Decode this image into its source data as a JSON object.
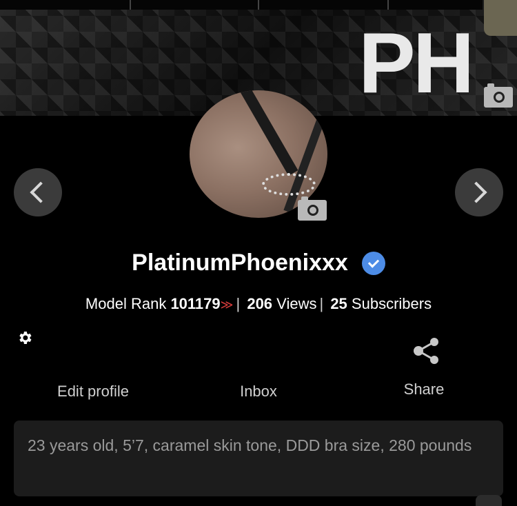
{
  "banner": {
    "logo_text": "PH",
    "camera_icon": "camera-icon"
  },
  "profile": {
    "username": "PlatinumPhoenixxx",
    "verified_icon": "verified-check-icon",
    "avatar_camera_icon": "camera-icon"
  },
  "nav": {
    "prev_icon": "chevron-left-icon",
    "next_icon": "chevron-right-icon"
  },
  "stats": {
    "rank_label": "Model Rank",
    "rank_value": "101179",
    "rank_trend_icon": "rank-down-icon",
    "views_value": "206",
    "views_label": "Views",
    "subscribers_value": "25",
    "subscribers_label": "Subscribers"
  },
  "actions": {
    "settings_icon": "gear-icon",
    "edit_profile_label": "Edit profile",
    "inbox_label": "Inbox",
    "share_icon": "share-icon",
    "share_label": "Share"
  },
  "bio": {
    "text": "23 years old, 5’7, caramel skin tone, DDD bra size, 280 pounds"
  },
  "colors": {
    "background": "#000000",
    "verified": "#4d8ce6",
    "rank_down": "#d23a3a",
    "bio_box": "#1c1c1c"
  }
}
